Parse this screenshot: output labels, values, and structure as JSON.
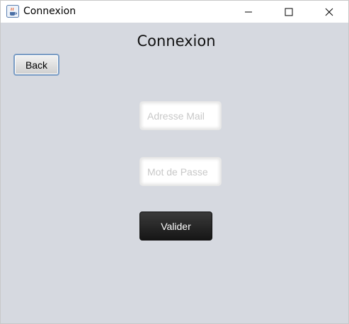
{
  "window": {
    "title": "Connexion",
    "app_icon": "java-coffee-cup-icon",
    "controls": {
      "minimize_icon": "minimize-icon",
      "maximize_icon": "maximize-icon",
      "close_icon": "close-icon"
    }
  },
  "page": {
    "heading": "Connexion",
    "back_label": "Back"
  },
  "form": {
    "email": {
      "value": "",
      "placeholder": "Adresse Mail"
    },
    "password": {
      "value": "",
      "placeholder": "Mot de Passe"
    },
    "submit_label": "Valider"
  },
  "colors": {
    "background": "#d6d9e0",
    "titlebar": "#ffffff",
    "submit_button": "#1f1f1f",
    "back_button_border": "#7a9cc4"
  }
}
